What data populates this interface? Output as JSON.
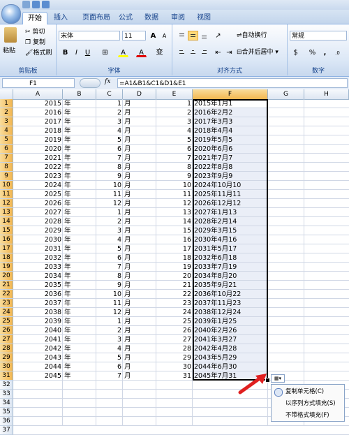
{
  "titlebar": {},
  "tabs": [
    "开始",
    "插入",
    "页面布局",
    "公式",
    "数据",
    "审阅",
    "视图"
  ],
  "active_tab": "开始",
  "clipboard": {
    "paste": "粘贴",
    "cut": "剪切",
    "copy": "复制",
    "format_painter": "格式刷",
    "label": "剪贴板"
  },
  "font": {
    "name": "宋体",
    "size": "11",
    "grow": "A",
    "shrink": "A",
    "bold": "B",
    "italic": "I",
    "underline": "U",
    "border": "⊞",
    "fill_color": "A",
    "font_color": "A",
    "wen": "变",
    "label": "字体"
  },
  "alignment": {
    "wrap": "自动换行",
    "merge": "合并后居中",
    "label": "对齐方式"
  },
  "number": {
    "format": "常规",
    "currency": "$",
    "percent": "%",
    "comma": ",",
    "label": "数字"
  },
  "formula_bar": {
    "cell_ref": "F1",
    "fx": "fx",
    "formula": "=A1&B1&C1&D1&E1"
  },
  "columns": [
    "A",
    "B",
    "C",
    "D",
    "E",
    "F",
    "G",
    "H"
  ],
  "active_col": "F",
  "rows": [
    {
      "n": 1,
      "a": "2015",
      "b": "年",
      "c": "1",
      "d": "月",
      "e": "1",
      "f": "2015年1月1"
    },
    {
      "n": 2,
      "a": "2016",
      "b": "年",
      "c": "2",
      "d": "月",
      "e": "2",
      "f": "2016年2月2"
    },
    {
      "n": 3,
      "a": "2017",
      "b": "年",
      "c": "3",
      "d": "月",
      "e": "3",
      "f": "2017年3月3"
    },
    {
      "n": 4,
      "a": "2018",
      "b": "年",
      "c": "4",
      "d": "月",
      "e": "4",
      "f": "2018年4月4"
    },
    {
      "n": 5,
      "a": "2019",
      "b": "年",
      "c": "5",
      "d": "月",
      "e": "5",
      "f": "2019年5月5"
    },
    {
      "n": 6,
      "a": "2020",
      "b": "年",
      "c": "6",
      "d": "月",
      "e": "6",
      "f": "2020年6月6"
    },
    {
      "n": 7,
      "a": "2021",
      "b": "年",
      "c": "7",
      "d": "月",
      "e": "7",
      "f": "2021年7月7"
    },
    {
      "n": 8,
      "a": "2022",
      "b": "年",
      "c": "8",
      "d": "月",
      "e": "8",
      "f": "2022年8月8"
    },
    {
      "n": 9,
      "a": "2023",
      "b": "年",
      "c": "9",
      "d": "月",
      "e": "9",
      "f": "2023年9月9"
    },
    {
      "n": 10,
      "a": "2024",
      "b": "年",
      "c": "10",
      "d": "月",
      "e": "10",
      "f": "2024年10月10"
    },
    {
      "n": 11,
      "a": "2025",
      "b": "年",
      "c": "11",
      "d": "月",
      "e": "11",
      "f": "2025年11月11"
    },
    {
      "n": 12,
      "a": "2026",
      "b": "年",
      "c": "12",
      "d": "月",
      "e": "12",
      "f": "2026年12月12"
    },
    {
      "n": 13,
      "a": "2027",
      "b": "年",
      "c": "1",
      "d": "月",
      "e": "13",
      "f": "2027年1月13"
    },
    {
      "n": 14,
      "a": "2028",
      "b": "年",
      "c": "2",
      "d": "月",
      "e": "14",
      "f": "2028年2月14"
    },
    {
      "n": 15,
      "a": "2029",
      "b": "年",
      "c": "3",
      "d": "月",
      "e": "15",
      "f": "2029年3月15"
    },
    {
      "n": 16,
      "a": "2030",
      "b": "年",
      "c": "4",
      "d": "月",
      "e": "16",
      "f": "2030年4月16"
    },
    {
      "n": 17,
      "a": "2031",
      "b": "年",
      "c": "5",
      "d": "月",
      "e": "17",
      "f": "2031年5月17"
    },
    {
      "n": 18,
      "a": "2032",
      "b": "年",
      "c": "6",
      "d": "月",
      "e": "18",
      "f": "2032年6月18"
    },
    {
      "n": 19,
      "a": "2033",
      "b": "年",
      "c": "7",
      "d": "月",
      "e": "19",
      "f": "2033年7月19"
    },
    {
      "n": 20,
      "a": "2034",
      "b": "年",
      "c": "8",
      "d": "月",
      "e": "20",
      "f": "2034年8月20"
    },
    {
      "n": 21,
      "a": "2035",
      "b": "年",
      "c": "9",
      "d": "月",
      "e": "21",
      "f": "2035年9月21"
    },
    {
      "n": 22,
      "a": "2036",
      "b": "年",
      "c": "10",
      "d": "月",
      "e": "22",
      "f": "2036年10月22"
    },
    {
      "n": 23,
      "a": "2037",
      "b": "年",
      "c": "11",
      "d": "月",
      "e": "23",
      "f": "2037年11月23"
    },
    {
      "n": 24,
      "a": "2038",
      "b": "年",
      "c": "12",
      "d": "月",
      "e": "24",
      "f": "2038年12月24"
    },
    {
      "n": 25,
      "a": "2039",
      "b": "年",
      "c": "1",
      "d": "月",
      "e": "25",
      "f": "2039年1月25"
    },
    {
      "n": 26,
      "a": "2040",
      "b": "年",
      "c": "2",
      "d": "月",
      "e": "26",
      "f": "2040年2月26"
    },
    {
      "n": 27,
      "a": "2041",
      "b": "年",
      "c": "3",
      "d": "月",
      "e": "27",
      "f": "2041年3月27"
    },
    {
      "n": 28,
      "a": "2042",
      "b": "年",
      "c": "4",
      "d": "月",
      "e": "28",
      "f": "2042年4月28"
    },
    {
      "n": 29,
      "a": "2043",
      "b": "年",
      "c": "5",
      "d": "月",
      "e": "29",
      "f": "2043年5月29"
    },
    {
      "n": 30,
      "a": "2044",
      "b": "年",
      "c": "6",
      "d": "月",
      "e": "30",
      "f": "2044年6月30"
    },
    {
      "n": 31,
      "a": "2045",
      "b": "年",
      "c": "7",
      "d": "月",
      "e": "31",
      "f": "2045年7月31"
    },
    {
      "n": 32
    },
    {
      "n": 33
    },
    {
      "n": 34
    },
    {
      "n": 35
    },
    {
      "n": 36
    },
    {
      "n": 37
    }
  ],
  "autofill_menu": {
    "items": [
      "复制单元格(C)",
      "以序列方式填充(S)",
      "不带格式填充(F)"
    ]
  },
  "colors": {
    "selection_border": "#000000",
    "selection_fill": "#eaeef7",
    "active_header": "#f4c163",
    "arrow": "#e02020"
  }
}
